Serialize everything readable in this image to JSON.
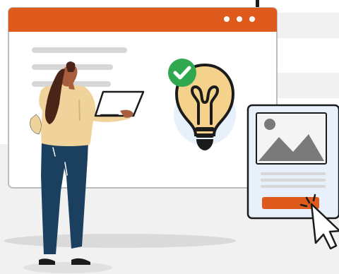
{
  "illustration": {
    "colors": {
      "background": "#ffffff",
      "panel_gray": "#f1f1f1",
      "accent_orange": "#de5b1d",
      "window_fill": "#ffffff",
      "window_border": "#bdbdbd",
      "text_lines": "#d7d7d7",
      "bulb_yellow": "#f4d28c",
      "bulb_glow": "#e7f1fb",
      "check_green": "#2fa84f",
      "sweater": "#efd39a",
      "pants": "#1b405f",
      "hair": "#4b2418",
      "skin": "#a85f3f",
      "dark": "#1b1b1b",
      "shadow": "#e3e3e3",
      "card_fill": "#e8f1fb",
      "image_gray": "#7a7a7a"
    },
    "icons": [
      "check-icon",
      "lightbulb-icon",
      "image-placeholder-icon",
      "mouse-cursor-icon",
      "window-dots-icon",
      "laptop-icon"
    ]
  }
}
